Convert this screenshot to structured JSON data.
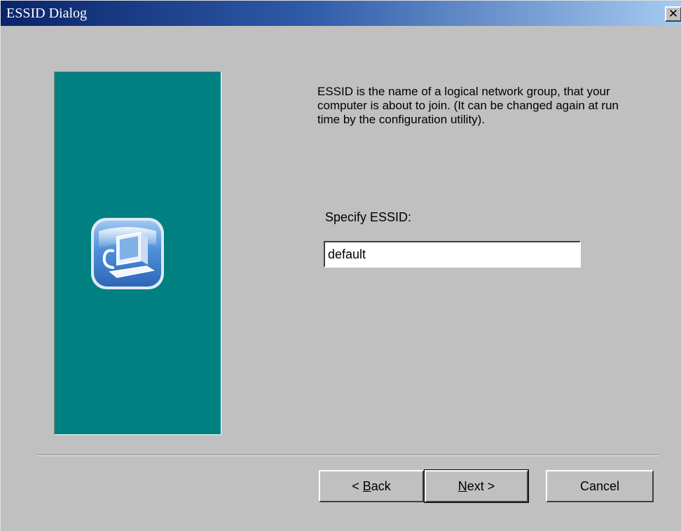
{
  "window": {
    "title": "ESSID Dialog"
  },
  "description": "ESSID is the name of a logical network group, that your computer is about to join. (It can be changed again at run time by the configuration utility).",
  "essid": {
    "label": "Specify ESSID:",
    "value": "default"
  },
  "buttons": {
    "back": {
      "prefix": "< ",
      "mnemonic": "B",
      "rest": "ack"
    },
    "next": {
      "mnemonic": "N",
      "rest": "ext >"
    },
    "cancel": "Cancel"
  },
  "icons": {
    "close": "close-icon",
    "wizard": "computer-setup-icon"
  },
  "colors": {
    "titlebar_start": "#0a246a",
    "titlebar_end": "#a6caf0",
    "banner": "#008080",
    "face": "#c0c0c0"
  }
}
